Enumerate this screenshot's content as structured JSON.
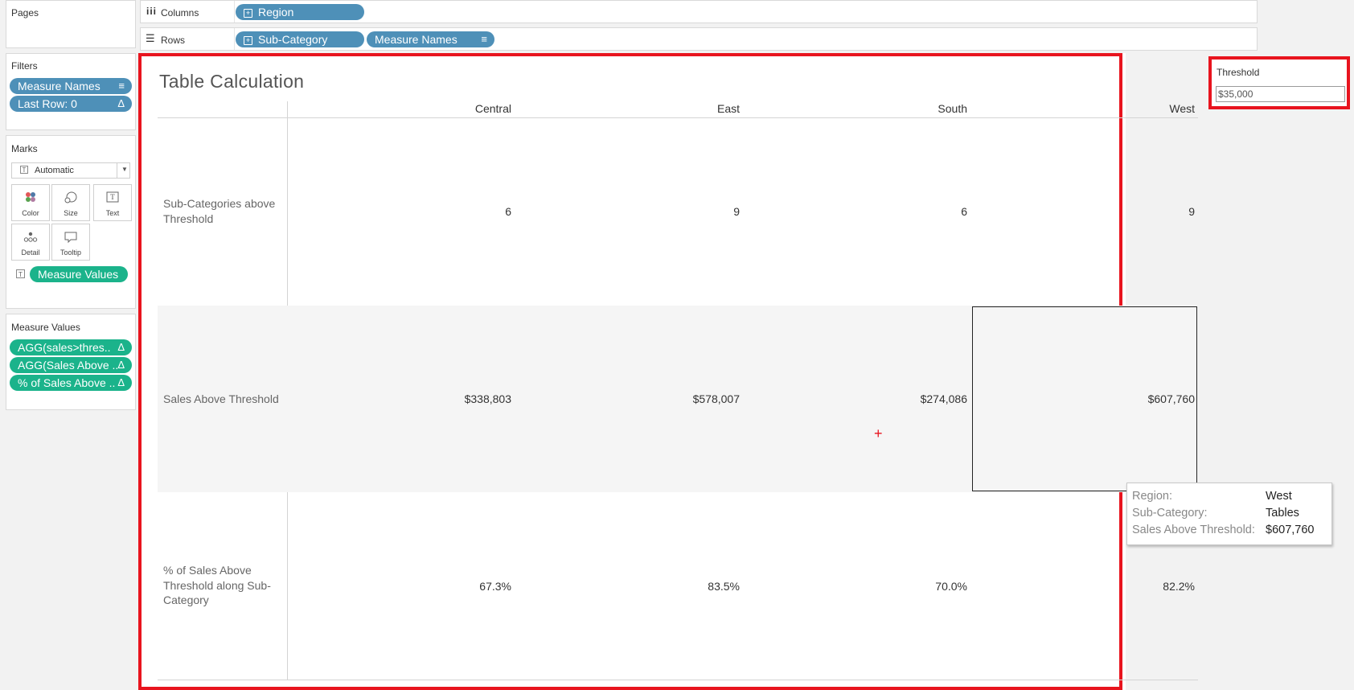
{
  "pages": {
    "title": "Pages"
  },
  "shelves": {
    "columns_label": "Columns",
    "rows_label": "Rows",
    "columns_pills": [
      "Region"
    ],
    "rows_pills": [
      "Sub-Category",
      "Measure Names"
    ]
  },
  "filters": {
    "title": "Filters",
    "items": [
      "Measure Names",
      "Last Row: 0"
    ]
  },
  "marks": {
    "title": "Marks",
    "mark_type": "Automatic",
    "buttons": [
      "Color",
      "Size",
      "Text",
      "Detail",
      "Tooltip"
    ],
    "pill": "Measure Values"
  },
  "measure_values": {
    "title": "Measure Values",
    "items": [
      "AGG(sales>thres..",
      "AGG(Sales Above ..",
      "% of Sales Above .."
    ]
  },
  "view": {
    "title": "Table Calculation",
    "columns": [
      "Central",
      "East",
      "South",
      "West"
    ],
    "rows": [
      {
        "label": "Sub-Categories above Threshold",
        "values": [
          "6",
          "9",
          "6",
          "9"
        ]
      },
      {
        "label": "Sales Above Threshold",
        "values": [
          "$338,803",
          "$578,007",
          "$274,086",
          "$607,760"
        ]
      },
      {
        "label": "% of Sales Above Threshold along Sub-Category",
        "values": [
          "67.3%",
          "83.5%",
          "70.0%",
          "82.2%"
        ]
      }
    ]
  },
  "tooltip": {
    "region_key": "Region:",
    "region_val": "West",
    "subcat_key": "Sub-Category:",
    "subcat_val": "Tables",
    "sales_key": "Sales Above Threshold:",
    "sales_val": "$607,760"
  },
  "parameter": {
    "title": "Threshold",
    "value": "$35,000"
  },
  "colors": {
    "blue_pill": "#4e90b8",
    "green_pill": "#1bb38b",
    "highlight_red": "#e8141e",
    "band_gray": "#f5f5f5"
  }
}
